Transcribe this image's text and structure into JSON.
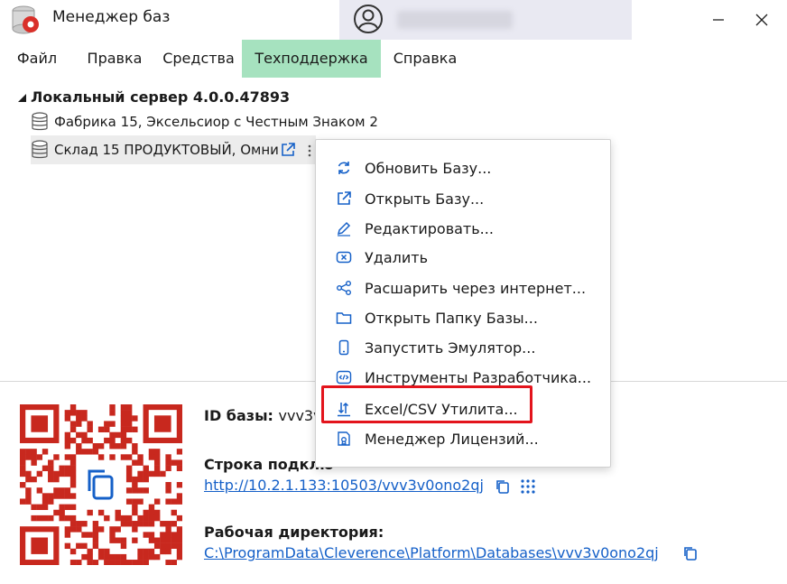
{
  "window": {
    "title": "Менеджер баз"
  },
  "menu": {
    "items": [
      {
        "label": "Файл"
      },
      {
        "label": "Правка"
      },
      {
        "label": "Средства"
      },
      {
        "label": "Техподдержка",
        "active": true
      },
      {
        "label": "Справка"
      }
    ]
  },
  "tree": {
    "root": "Локальный сервер 4.0.0.47893",
    "nodes": [
      {
        "label": "Фабрика 15, Экcельсиор с Честным Знаком 2"
      },
      {
        "label": "Склад 15 ПРОДУКТОВЫЙ, Омни"
      }
    ]
  },
  "context_menu": {
    "items": [
      {
        "label": "Обновить Базу...",
        "icon": "refresh-icon"
      },
      {
        "label": "Открыть Базу...",
        "icon": "open-external-icon"
      },
      {
        "label": "Редактировать...",
        "icon": "pencil-icon"
      },
      {
        "label": "Удалить",
        "icon": "delete-icon"
      },
      {
        "label": "Расшарить через интернет...",
        "icon": "share-icon"
      },
      {
        "label": "Открыть Папку Базы...",
        "icon": "folder-icon"
      },
      {
        "label": "Запустить Эмулятор...",
        "icon": "phone-icon"
      },
      {
        "label": "Инструменты Разработчика...",
        "icon": "code-icon"
      },
      {
        "label": "Excel/CSV Утилита...",
        "icon": "import-export-icon"
      },
      {
        "label": "Менеджер Лицензий...",
        "icon": "license-icon"
      }
    ]
  },
  "info": {
    "id_label": "ID базы:",
    "id_value": "vvv3v",
    "conn_label": "Строка подклю",
    "conn_url": "http://10.2.1.133:10503/vvv3v0ono2qj",
    "dir_label": "Рабочая директория:",
    "dir_path": "C:\\ProgramData\\Cleverence\\Platform\\Databases\\vvv3v0ono2qj"
  },
  "colors": {
    "accent_blue": "#1560c8",
    "active_menu": "#a6e2bf",
    "highlight_red": "#e3141c",
    "qr_red": "#c8281e"
  }
}
